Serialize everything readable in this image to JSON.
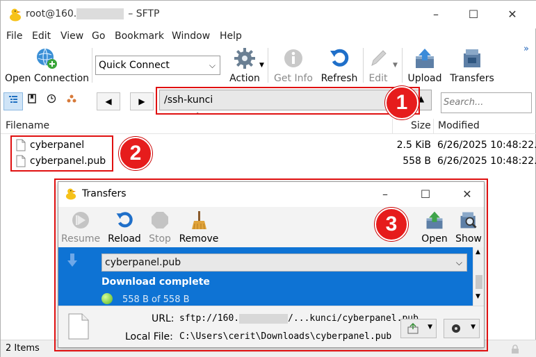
{
  "window": {
    "title_prefix": "root@160.",
    "title_suffix": "– SFTP",
    "controls": {
      "minimize": "–",
      "maximize": "☐",
      "close": "✕"
    }
  },
  "menu": [
    "File",
    "Edit",
    "View",
    "Go",
    "Bookmark",
    "Window",
    "Help"
  ],
  "toolbar": {
    "open_connection": "Open Connection",
    "quick_connect": "Quick Connect",
    "action": "Action",
    "get_info": "Get Info",
    "refresh": "Refresh",
    "edit": "Edit",
    "upload": "Upload",
    "transfers": "Transfers",
    "overflow": "»"
  },
  "nav": {
    "back": "◀",
    "forward": "▶",
    "path": "/ssh-kunci",
    "search_placeholder": "Search..."
  },
  "columns": {
    "filename": "Filename",
    "size": "Size",
    "modified": "Modified"
  },
  "files": [
    {
      "name": "cyberpanel",
      "size": "2.5 KiB",
      "modified": "6/26/2025 10:48:22..."
    },
    {
      "name": "cyberpanel.pub",
      "size": "558 B",
      "modified": "6/26/2025 10:48:22..."
    }
  ],
  "status": {
    "items": "2 Items"
  },
  "annotations": {
    "one": "1",
    "two": "2",
    "three": "3"
  },
  "transfers_window": {
    "title": "Transfers",
    "controls": {
      "minimize": "–",
      "maximize": "☐",
      "close": "✕"
    },
    "toolbar": {
      "resume": "Resume",
      "reload": "Reload",
      "stop": "Stop",
      "remove": "Remove",
      "open": "Open",
      "show": "Show"
    },
    "item": {
      "file": "cyberpanel.pub",
      "state": "Download complete",
      "progress": "558 B of 558 B"
    },
    "details": {
      "url_label": "URL:",
      "url_prefix": "sftp://160.",
      "url_suffix": "/...kunci/cyberpanel.pub",
      "local_label": "Local File:",
      "local_value": "C:\\Users\\cerit\\Downloads\\cyberpanel.pub"
    }
  },
  "colors": {
    "accent": "#0e73d4",
    "annotation": "#e61c1c",
    "panel": "#f3f3f3"
  }
}
